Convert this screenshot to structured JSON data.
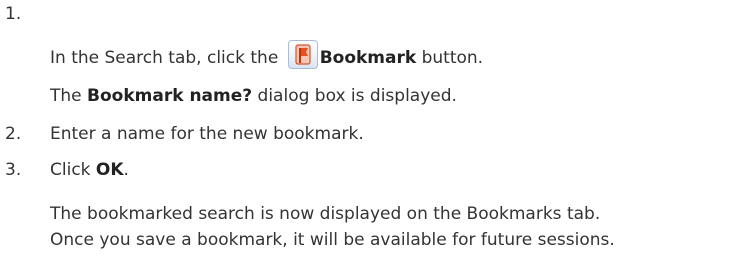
{
  "steps": [
    {
      "number": "1.",
      "text_before": "In the Search tab, click the",
      "icon": "bookmark-flag-icon",
      "bold": "Bookmark",
      "text_after": " button.",
      "result_pre": "The ",
      "result_bold": "Bookmark name?",
      "result_post": " dialog box is displayed."
    },
    {
      "number": "2.",
      "text": "Enter a name for the new bookmark."
    },
    {
      "number": "3.",
      "text_before": "Click ",
      "bold": "OK",
      "text_after": ".",
      "result_line1": "The bookmarked search is now displayed on the Bookmarks tab.",
      "result_line2": "Once you save a bookmark, it will be available for future sessions."
    }
  ],
  "colors": {
    "text": "#333333",
    "icon_flag": "#e8501f",
    "icon_frame": "#a9bcd6"
  }
}
